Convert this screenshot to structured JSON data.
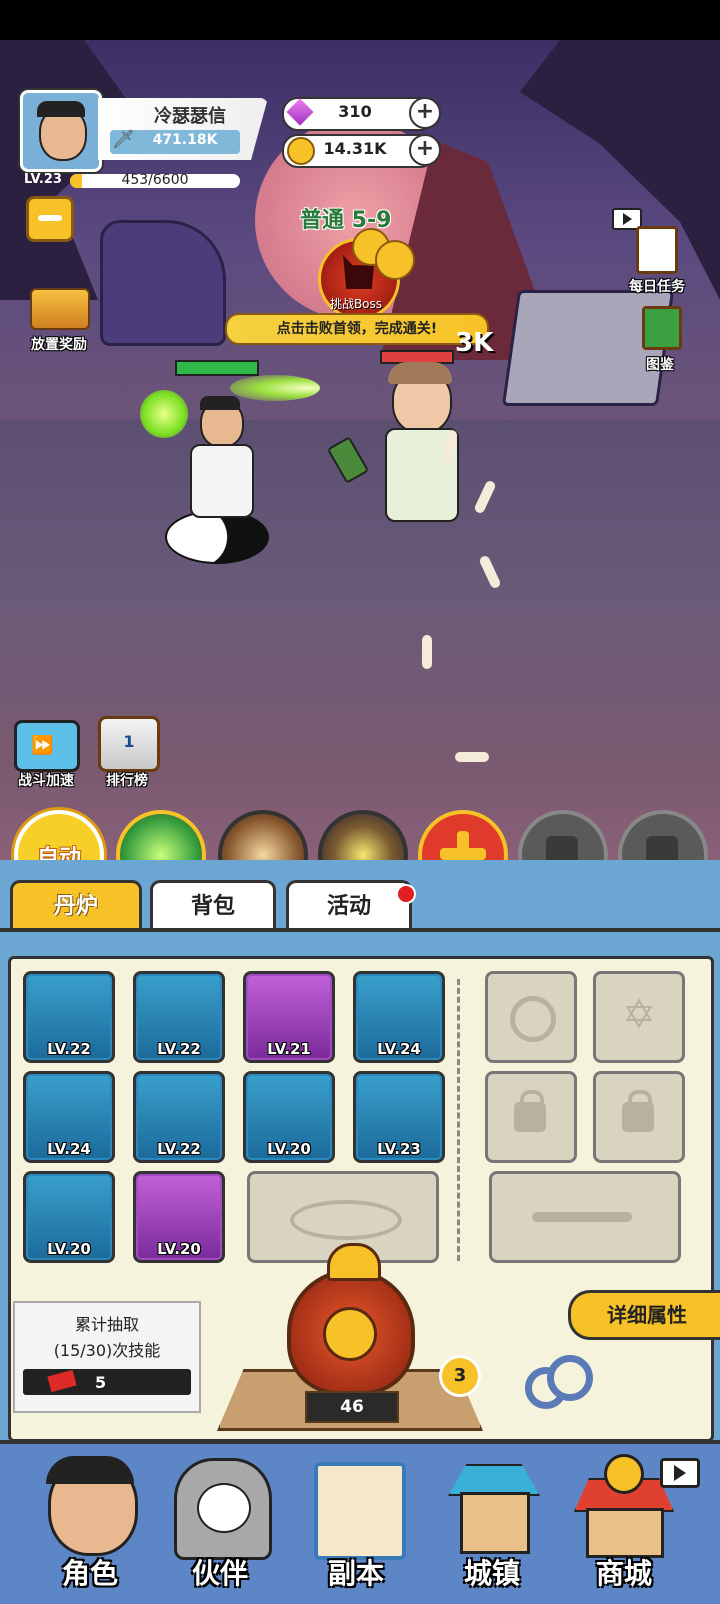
{
  "player": {
    "name": "冷瑟瑟信",
    "power": "471.18K",
    "level": "LV.23",
    "exp": "453/6600",
    "exp_fraction": 0.069
  },
  "currency": {
    "gems": "310",
    "coins": "14.31K"
  },
  "stage": {
    "title": "普通 5-9",
    "boss_label": "挑战Boss",
    "hint": "点击击败首领，完成通关!",
    "damage_text": "3K"
  },
  "side_buttons": {
    "idle_reward": "放置奖励",
    "daily_tasks": "每日任务",
    "codex": "图鉴",
    "battle_speed": "战斗加速",
    "ranking": "排行榜"
  },
  "skill_bar": {
    "auto_label": "自动"
  },
  "tabs": [
    {
      "label": "丹炉",
      "active": true
    },
    {
      "label": "背包",
      "active": false
    },
    {
      "label": "活动",
      "active": false,
      "badge": true
    }
  ],
  "equipment": [
    {
      "level": "LV.22",
      "rarity": "blue",
      "icon": "sword-icon"
    },
    {
      "level": "LV.22",
      "rarity": "blue",
      "icon": "jade-blade-icon"
    },
    {
      "level": "LV.21",
      "rarity": "purple",
      "icon": "armor-icon"
    },
    {
      "level": "LV.24",
      "rarity": "blue",
      "icon": "spirit-orb-icon"
    },
    {
      "level": "LV.24",
      "rarity": "blue",
      "icon": "scroll-icon"
    },
    {
      "level": "LV.22",
      "rarity": "blue",
      "icon": "jade-plate-icon"
    },
    {
      "level": "LV.20",
      "rarity": "blue",
      "icon": "pendant-icon"
    },
    {
      "level": "LV.23",
      "rarity": "blue",
      "icon": "water-orb-icon"
    },
    {
      "level": "LV.20",
      "rarity": "blue",
      "icon": "belt-icon"
    },
    {
      "level": "LV.20",
      "rarity": "purple",
      "icon": "boots-icon"
    }
  ],
  "draw": {
    "line1": "累计抽取",
    "line2": "(15/30)次技能",
    "tickets": "5"
  },
  "furnace": {
    "count": "46",
    "level": "3"
  },
  "detail_button": "详细属性",
  "nav": [
    {
      "label": "角色"
    },
    {
      "label": "伙伴"
    },
    {
      "label": "副本"
    },
    {
      "label": "城镇"
    },
    {
      "label": "商城"
    }
  ],
  "colors": {
    "panel_blue": "#6ca7d4",
    "nav_blue": "#5c86c6",
    "accent_yellow": "#f7c227",
    "rare_blue": "#2a8ac0",
    "epic_purple": "#a44ac4"
  }
}
